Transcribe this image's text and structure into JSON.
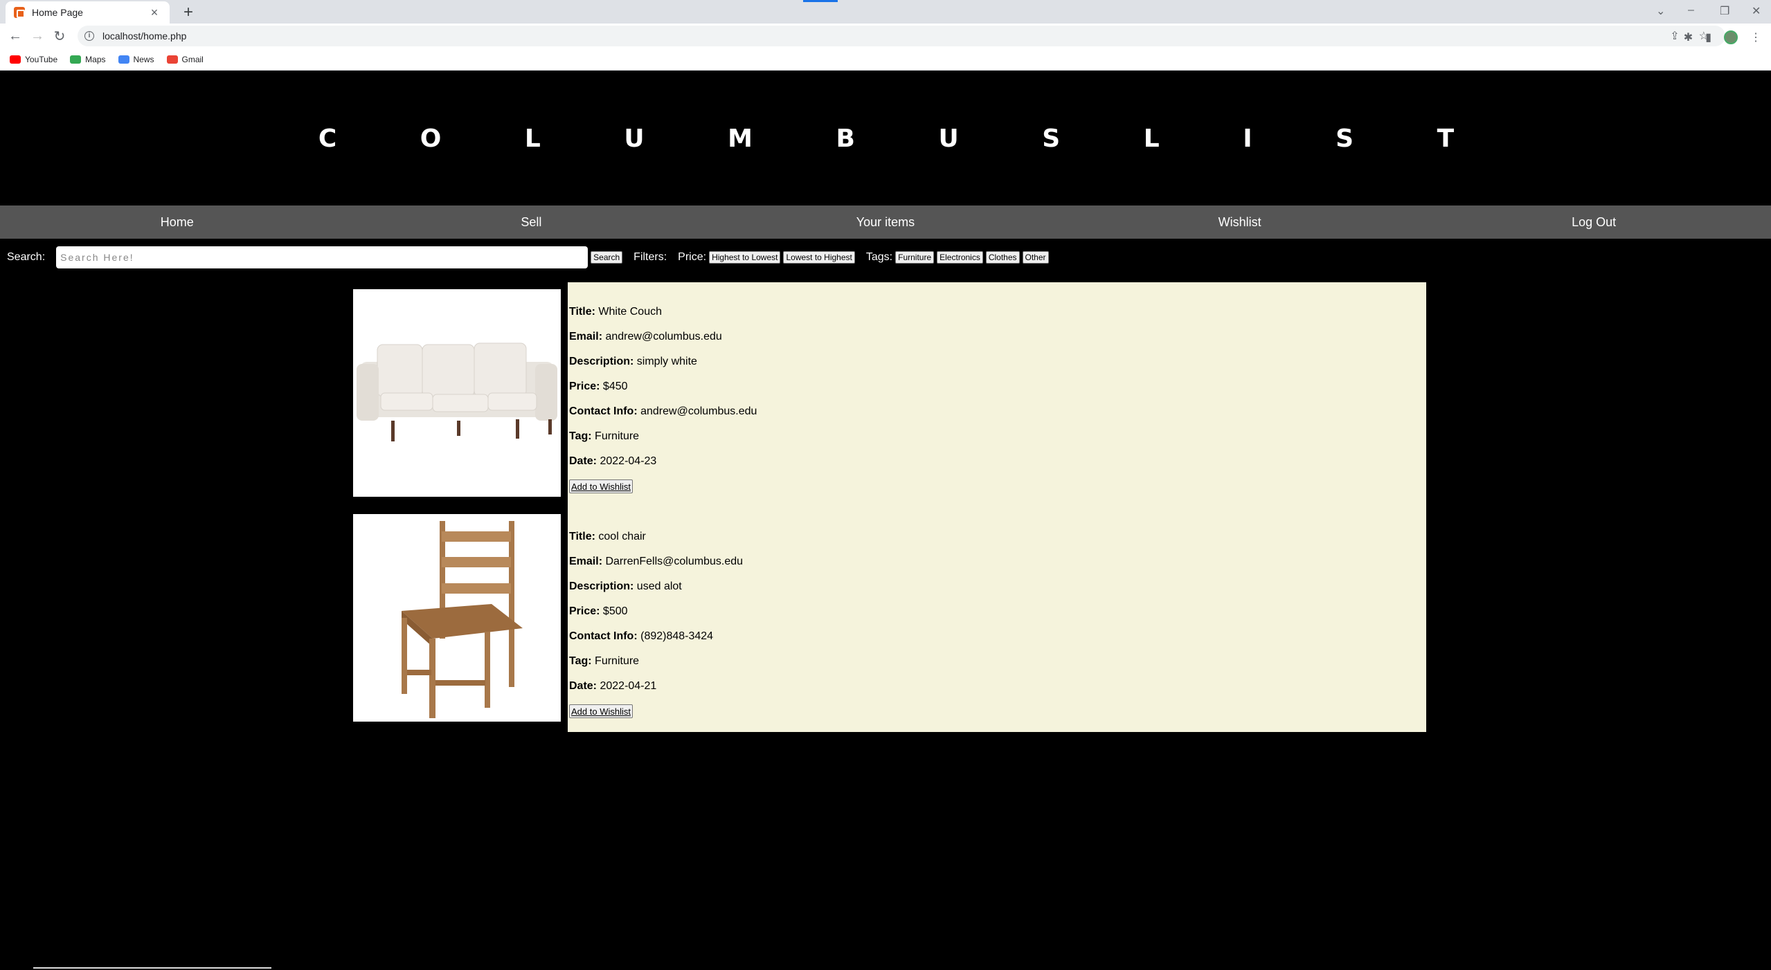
{
  "browser": {
    "tab_title": "Home Page",
    "tab_close": "×",
    "new_tab": "+",
    "url": "localhost/home.php",
    "bookmarks": [
      {
        "label": "YouTube",
        "color": "#ff0000"
      },
      {
        "label": "Maps",
        "color": "#34a853"
      },
      {
        "label": "News",
        "color": "#4285f4"
      },
      {
        "label": "Gmail",
        "color": "#ea4335"
      }
    ]
  },
  "site": {
    "title": "C O L U M B U S L I S T",
    "nav": [
      "Home",
      "Sell",
      "Your items",
      "Wishlist",
      "Log Out"
    ]
  },
  "search": {
    "label": "Search:",
    "placeholder": "Search Here!",
    "button": "Search",
    "filters_label": "Filters:",
    "price_label": "Price:",
    "price_high_low": "Highest to Lowest",
    "price_low_high": "Lowest to Highest",
    "tags_label": "Tags:",
    "tags": [
      "Furniture",
      "Electronics",
      "Clothes",
      "Other"
    ]
  },
  "listings": [
    {
      "title_label": "Title:",
      "title": "White Couch",
      "email_label": "Email:",
      "email": "andrew@columbus.edu",
      "description_label": "Description:",
      "description": "simply white",
      "price_label": "Price:",
      "price": "$450",
      "contact_label": "Contact Info:",
      "contact": "andrew@columbus.edu",
      "tag_label": "Tag:",
      "tag": "Furniture",
      "date_label": "Date:",
      "date": "2022-04-23",
      "button": "Add to Wishlist"
    },
    {
      "title_label": "Title:",
      "title": "cool chair",
      "email_label": "Email:",
      "email": "DarrenFells@columbus.edu",
      "description_label": "Description:",
      "description": "used alot",
      "price_label": "Price:",
      "price": "$500",
      "contact_label": "Contact Info:",
      "contact": "(892)848-3424",
      "tag_label": "Tag:",
      "tag": "Furniture",
      "date_label": "Date:",
      "date": "2022-04-21",
      "button": "Add to Wishlist"
    }
  ]
}
